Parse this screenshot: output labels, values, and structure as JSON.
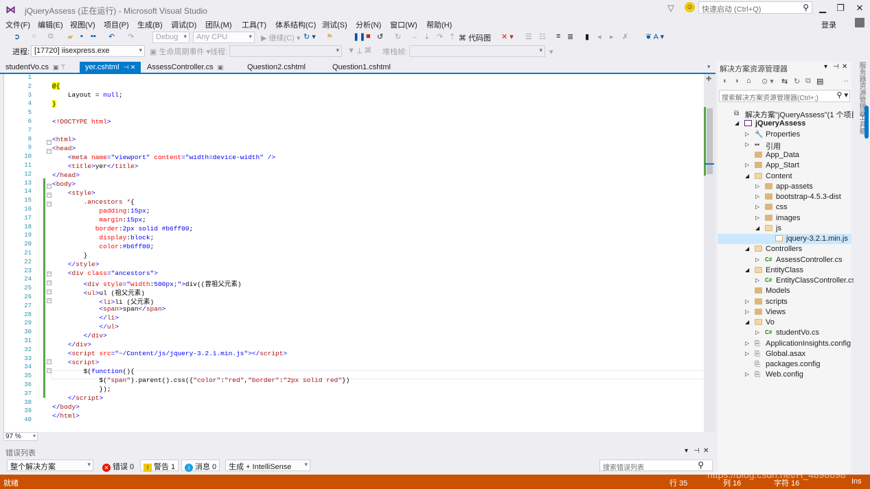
{
  "window": {
    "title": "jQueryAssess (正在运行) - Microsoft Visual Studio",
    "quick_launch_placeholder": "快速启动 (Ctrl+Q)",
    "minimize": "▁",
    "restore": "❐",
    "close": "✕"
  },
  "menu": [
    "文件(F)",
    "编辑(E)",
    "视图(V)",
    "项目(P)",
    "生成(B)",
    "调试(D)",
    "团队(M)",
    "工具(T)",
    "体系结构(C)",
    "测试(S)",
    "分析(N)",
    "窗口(W)",
    "帮助(H)"
  ],
  "login_label": "登录",
  "toolbar": {
    "config": "Debug",
    "platform": "Any CPU",
    "continue": "继续(C)",
    "code_map": "代码图",
    "process_label": "进程:",
    "process_value": "[17720] iisexpress.exe",
    "lifecycle": "生命周期事件",
    "thread_label": "线程:",
    "stack_label": "堆栈帧:"
  },
  "tabs": [
    {
      "label": "studentVo.cs",
      "active": false
    },
    {
      "label": "yer.cshtml",
      "active": true
    },
    {
      "label": "AssessController.cs",
      "active": false
    },
    {
      "label": "Question2.cshtml",
      "active": false
    },
    {
      "label": "Question1.cshtml",
      "active": false
    }
  ],
  "editor": {
    "line_numbers": [
      "1",
      "2",
      "3",
      "4",
      "5",
      "6",
      "7",
      "8",
      "9",
      "10",
      "11",
      "12",
      "13",
      "14",
      "15",
      "16",
      "17",
      "18",
      "19",
      "20",
      "21",
      "22",
      "23",
      "24",
      "25",
      "26",
      "27",
      "28",
      "29",
      "30",
      "31",
      "32",
      "33",
      "34",
      "35",
      "36",
      "37",
      "38",
      "39",
      "40"
    ],
    "zoom": "97 %"
  },
  "error_list": {
    "title": "错误列表",
    "scope": "整个解决方案",
    "errors": "错误 0",
    "warnings": "警告 1",
    "messages": "消息 0",
    "build_filter": "生成 + IntelliSense",
    "search_placeholder": "搜索错误列表"
  },
  "solution_explorer": {
    "title": "解决方案资源管理器",
    "search_placeholder": "搜索解决方案资源管理器(Ctrl+;)",
    "items": [
      {
        "label": "解决方案\"jQueryAssess\"(1 个项目)",
        "icon": "solution-icon",
        "indent": 0,
        "arrow": ""
      },
      {
        "label": "jQueryAssess",
        "icon": "project-icon",
        "indent": 1,
        "arrow": "◢",
        "bold": true
      },
      {
        "label": "Properties",
        "icon": "wrench-icon",
        "indent": 2,
        "arrow": "▷"
      },
      {
        "label": "引用",
        "icon": "references-icon",
        "indent": 2,
        "arrow": "▷"
      },
      {
        "label": "App_Data",
        "icon": "folder-icon",
        "indent": 2,
        "arrow": ""
      },
      {
        "label": "App_Start",
        "icon": "folder-icon",
        "indent": 2,
        "arrow": "▷"
      },
      {
        "label": "Content",
        "icon": "folder-open-icon",
        "indent": 2,
        "arrow": "◢"
      },
      {
        "label": "app-assets",
        "icon": "folder-icon",
        "indent": 3,
        "arrow": "▷"
      },
      {
        "label": "bootstrap-4.5.3-dist",
        "icon": "folder-icon",
        "indent": 3,
        "arrow": "▷"
      },
      {
        "label": "css",
        "icon": "folder-icon",
        "indent": 3,
        "arrow": "▷"
      },
      {
        "label": "images",
        "icon": "folder-icon",
        "indent": 3,
        "arrow": "▷"
      },
      {
        "label": "js",
        "icon": "folder-open-icon",
        "indent": 3,
        "arrow": "◢"
      },
      {
        "label": "jquery-3.2.1.min.js",
        "icon": "js-file-icon",
        "indent": 4,
        "arrow": "",
        "selected": true
      },
      {
        "label": "Controllers",
        "icon": "folder-open-icon",
        "indent": 2,
        "arrow": "◢"
      },
      {
        "label": "AssessController.cs",
        "icon": "csharp-icon",
        "indent": 3,
        "arrow": "▷"
      },
      {
        "label": "EntityClass",
        "icon": "folder-open-icon",
        "indent": 2,
        "arrow": "◢"
      },
      {
        "label": "EntityClassController.cs",
        "icon": "csharp-icon",
        "indent": 3,
        "arrow": "▷"
      },
      {
        "label": "Models",
        "icon": "folder-icon",
        "indent": 2,
        "arrow": ""
      },
      {
        "label": "scripts",
        "icon": "folder-icon",
        "indent": 2,
        "arrow": "▷"
      },
      {
        "label": "Views",
        "icon": "folder-icon",
        "indent": 2,
        "arrow": "▷"
      },
      {
        "label": "Vo",
        "icon": "folder-open-icon",
        "indent": 2,
        "arrow": "◢"
      },
      {
        "label": "studentVo.cs",
        "icon": "csharp-icon",
        "indent": 3,
        "arrow": "▷"
      },
      {
        "label": "ApplicationInsights.config",
        "icon": "config-icon",
        "indent": 2,
        "arrow": "▷"
      },
      {
        "label": "Global.asax",
        "icon": "config-icon",
        "indent": 2,
        "arrow": "▷"
      },
      {
        "label": "packages.config",
        "icon": "config-icon",
        "indent": 2,
        "arrow": ""
      },
      {
        "label": "Web.config",
        "icon": "config-icon",
        "indent": 2,
        "arrow": "▷"
      }
    ]
  },
  "rail": {
    "server_explorer": "服务器资源管理器",
    "toolbox": "工具箱"
  },
  "status": {
    "ready": "就绪",
    "line": "行 35",
    "col": "列 16",
    "char": "字符 16",
    "ins": "Ins"
  },
  "watermark": "https://blog.csdn.net/H_4898698",
  "colors": {
    "accent": "#007acc",
    "status_bar": "#ca5100",
    "keyword": "#0000ff",
    "tag": "#a31515",
    "attr": "#ff0000"
  }
}
